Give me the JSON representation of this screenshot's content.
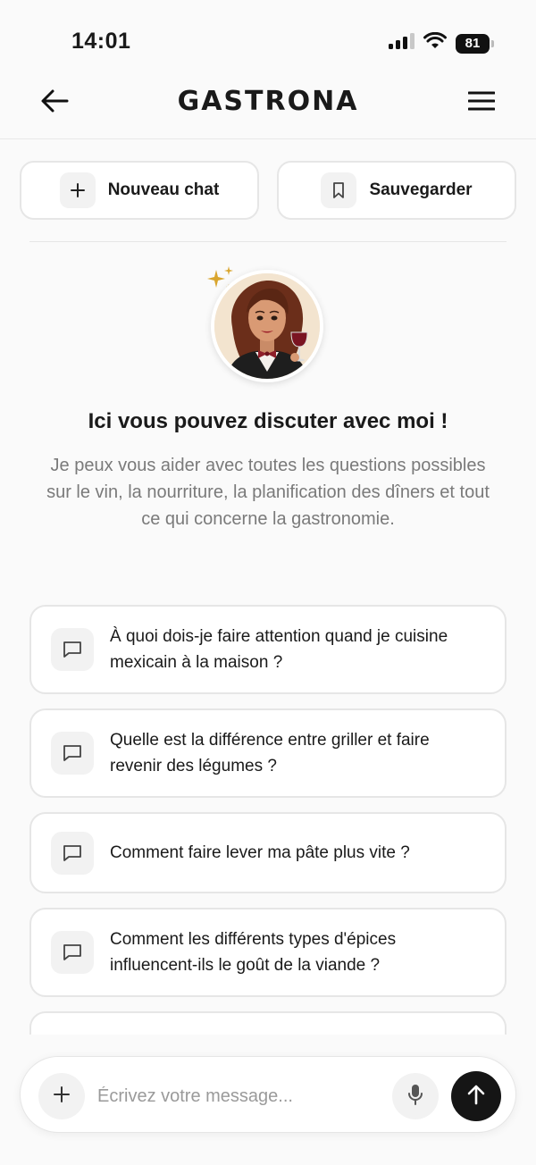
{
  "status_bar": {
    "time": "14:01",
    "battery": "81"
  },
  "header": {
    "brand": "GASTRONA"
  },
  "actions": {
    "new_chat": "Nouveau chat",
    "save": "Sauvegarder"
  },
  "intro": {
    "title": "Ici vous pouvez discuter avec moi !",
    "text": "Je peux vous aider avec toutes les questions possibles sur le vin, la nourriture, la planification des dîners et tout ce qui concerne la gastronomie."
  },
  "suggestions": [
    "À quoi dois-je faire attention quand je cuisine mexicain à la maison ?",
    "Quelle est la différence entre griller et faire revenir des légumes ?",
    "Comment faire lever ma pâte plus vite ?",
    "Comment les différents types d'épices influencent-ils le goût de la viande ?",
    ""
  ],
  "composer": {
    "placeholder": "Écrivez votre message..."
  }
}
